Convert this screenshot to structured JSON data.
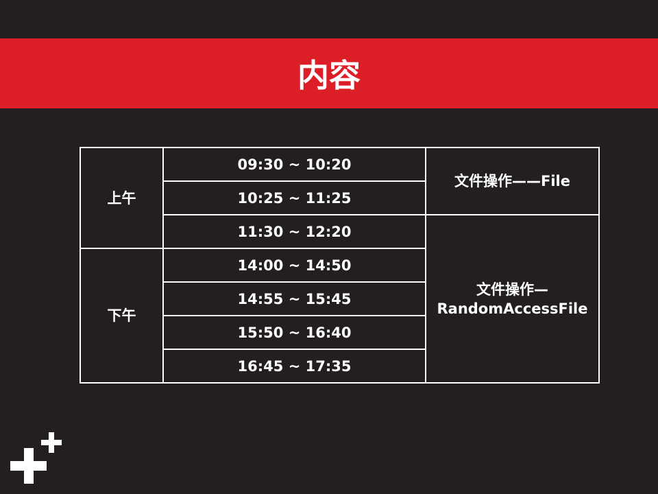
{
  "title": "内容",
  "periods": [
    {
      "label": "上午"
    },
    {
      "label": "下午"
    }
  ],
  "times": [
    "09:30 ~ 10:20",
    "10:25 ~ 11:25",
    "11:30 ~ 12:20",
    "14:00 ~ 14:50",
    "14:55 ~ 15:45",
    "15:50 ~ 16:40",
    "16:45 ~ 17:35"
  ],
  "topics": [
    {
      "line1": "文件操作——File"
    },
    {
      "line1": "文件操作—",
      "line2": "RandomAccessFile"
    }
  ],
  "colors": {
    "background": "#231f20",
    "accent": "#dc1f26"
  },
  "logo": "plus-plus-icon"
}
